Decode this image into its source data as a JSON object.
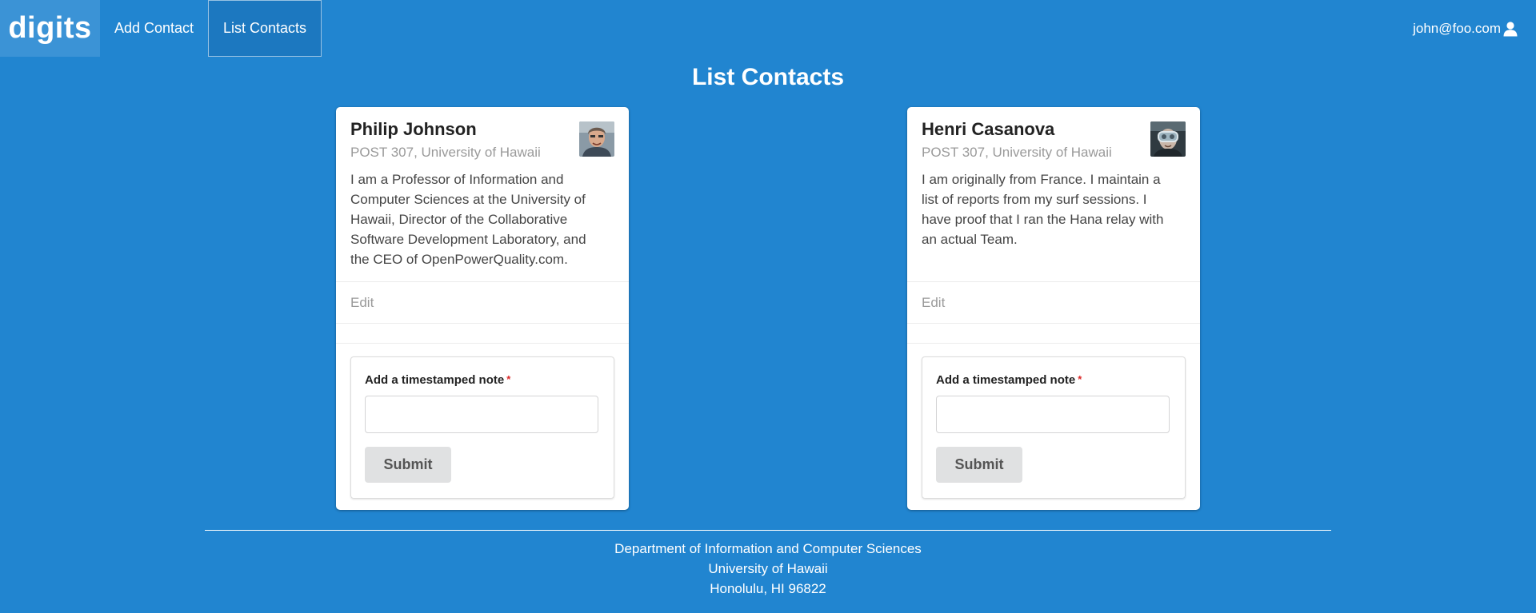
{
  "nav": {
    "brand": "digits",
    "items": [
      {
        "label": "Add Contact"
      },
      {
        "label": "List Contacts",
        "active": true
      }
    ],
    "user": "john@foo.com"
  },
  "page": {
    "title": "List Contacts"
  },
  "contacts": [
    {
      "name": "Philip Johnson",
      "address": "POST 307, University of Hawaii",
      "description": "I am a Professor of Information and Computer Sciences at the University of Hawaii, Director of the Collaborative Software Development Laboratory, and the CEO of OpenPowerQuality.com.",
      "edit_label": "Edit",
      "note_label": "Add a timestamped note",
      "note_value": "",
      "submit_label": "Submit"
    },
    {
      "name": "Henri Casanova",
      "address": "POST 307, University of Hawaii",
      "description": "I am originally from France. I maintain a list of reports from my surf sessions. I have proof that I ran the Hana relay with an actual Team.",
      "edit_label": "Edit",
      "note_label": "Add a timestamped note",
      "note_value": "",
      "submit_label": "Submit"
    }
  ],
  "footer": {
    "lines": [
      "Department of Information and Computer Sciences",
      "University of Hawaii",
      "Honolulu, HI 96822"
    ]
  },
  "colors": {
    "background": "#2185d0",
    "required": "#db2828"
  }
}
